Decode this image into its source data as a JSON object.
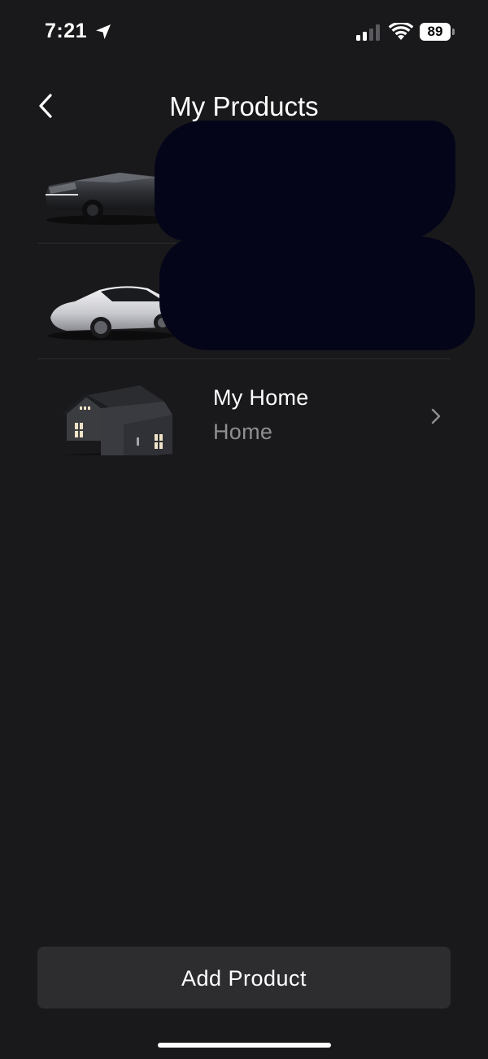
{
  "status_bar": {
    "time": "7:21",
    "battery_level": "89",
    "signal_bars": 2,
    "icons": [
      "location-arrow-icon",
      "cellular-signal-icon",
      "wifi-icon",
      "battery-icon"
    ]
  },
  "header": {
    "title": "My Products",
    "back_icon": "chevron-left-icon"
  },
  "products": [
    {
      "name": "",
      "subtitle": "",
      "image": "cybertruck-image",
      "redacted": true
    },
    {
      "name": "",
      "subtitle": "",
      "image": "model-3-car-image",
      "redacted": true
    },
    {
      "name": "My Home",
      "subtitle": "Home",
      "image": "solar-house-image",
      "redacted": false
    }
  ],
  "footer": {
    "add_product_label": "Add Product"
  },
  "colors": {
    "background": "#19191b",
    "text_primary": "#ffffff",
    "text_secondary": "#8e8e93",
    "button_bg": "#2d2d30",
    "divider": "#2c2c2f",
    "redaction": "#05051a"
  }
}
